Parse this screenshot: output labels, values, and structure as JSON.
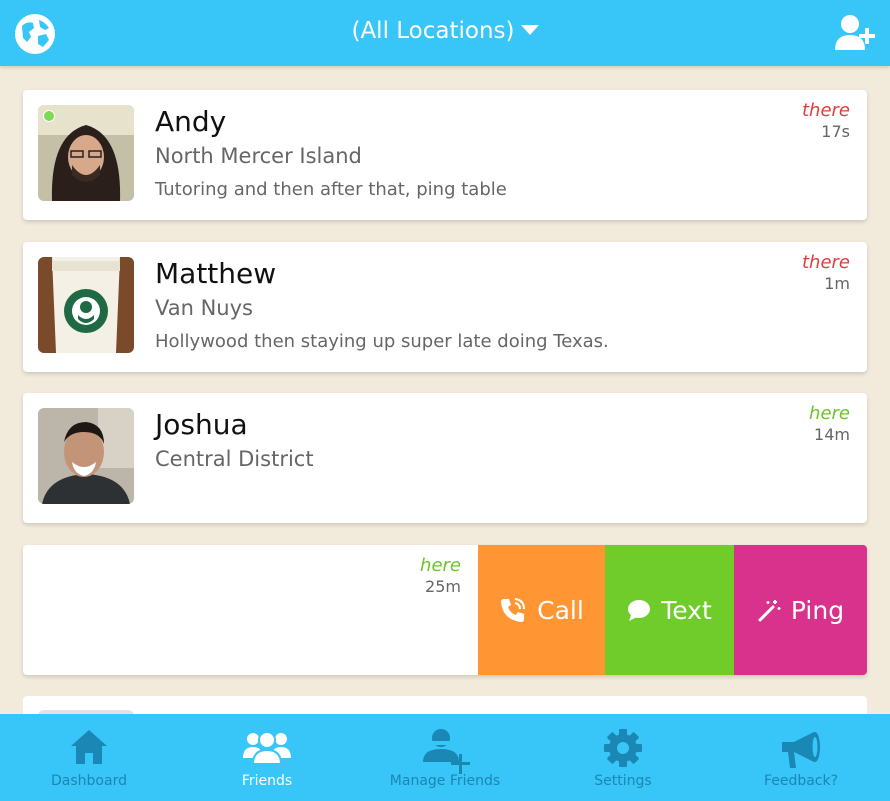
{
  "header": {
    "location_selector": "(All Locations)",
    "left_icon": "globe-icon",
    "right_icon": "add-user-icon"
  },
  "friends": [
    {
      "name": "Andy",
      "area": "North Mercer Island",
      "note": "Tutoring and then after that, ping table",
      "status": "there",
      "ago": "17s",
      "online": true
    },
    {
      "name": "Matthew",
      "area": "Van Nuys",
      "note": "Hollywood then staying up super late doing Texas.",
      "status": "there",
      "ago": "1m"
    },
    {
      "name": "Joshua",
      "area": "Central District",
      "note": "",
      "status": "here",
      "ago": "14m"
    },
    {
      "status": "here",
      "ago": "25m"
    }
  ],
  "row_actions": {
    "call": "Call",
    "text": "Text",
    "ping": "Ping"
  },
  "colors": {
    "primary": "#38c5f8",
    "background": "#f2ebdb",
    "there": "#e23c3c",
    "here": "#6ec42a",
    "call": "#ff9533",
    "text": "#70cc2b",
    "ping": "#d9328d"
  },
  "nav": [
    {
      "label": "Dashboard",
      "icon": "home-icon"
    },
    {
      "label": "Friends",
      "icon": "friends-icon",
      "active": true
    },
    {
      "label": "Manage Friends",
      "icon": "manage-friends-icon"
    },
    {
      "label": "Settings",
      "icon": "gear-icon"
    },
    {
      "label": "Feedback?",
      "icon": "megaphone-icon"
    }
  ]
}
